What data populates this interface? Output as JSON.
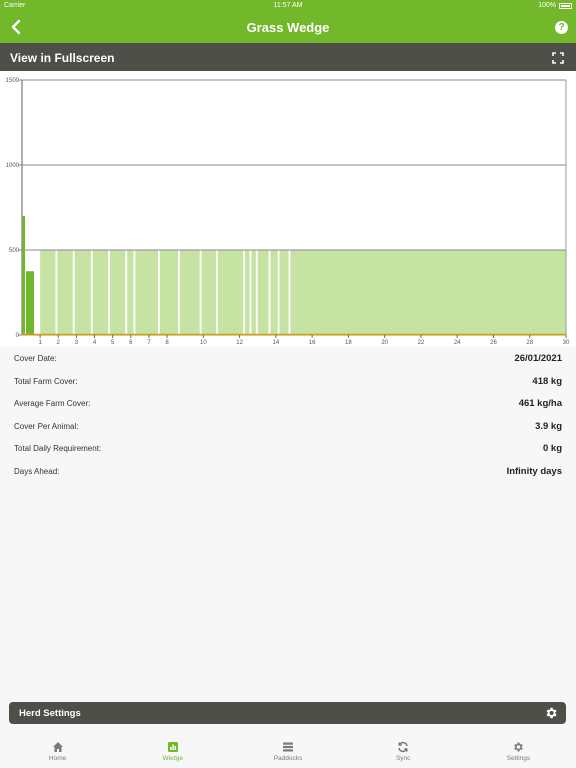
{
  "status_bar": {
    "carrier": "Carrier",
    "time": "11:57 AM",
    "battery": "100%"
  },
  "nav": {
    "title": "Grass Wedge"
  },
  "fullscreen_bar": {
    "label": "View in Fullscreen"
  },
  "stats": [
    {
      "label": "Cover Date:",
      "value": "26/01/2021"
    },
    {
      "label": "Total Farm Cover:",
      "value": "418 kg"
    },
    {
      "label": "Average Farm Cover:",
      "value": "461 kg/ha"
    },
    {
      "label": "Cover Per Animal:",
      "value": "3.9 kg"
    },
    {
      "label": "Total Daily Requirement:",
      "value": "0 kg"
    },
    {
      "label": "Days Ahead:",
      "value": "Infinity days"
    }
  ],
  "herd_settings": {
    "label": "Herd Settings"
  },
  "tabs": [
    {
      "label": "Home",
      "icon": "home-icon"
    },
    {
      "label": "Wedge",
      "icon": "bar-chart-icon"
    },
    {
      "label": "Paddocks",
      "icon": "list-icon"
    },
    {
      "label": "Sync",
      "icon": "sync-icon"
    },
    {
      "label": "Settings",
      "icon": "gear-icon"
    }
  ],
  "colors": {
    "brand_green": "#73b72b",
    "dark_bar": "#4d4f48",
    "bar_light": "#c6e3a4",
    "bar_dark": "#6db82e",
    "target_line": "#d6a100"
  },
  "chart_data": {
    "type": "bar",
    "ylim": [
      0,
      1500
    ],
    "yticks": [
      0,
      500,
      1000,
      1500
    ],
    "xticks": [
      1,
      2,
      3,
      4,
      5,
      6,
      7,
      8,
      10,
      12,
      14,
      16,
      18,
      20,
      22,
      24,
      26,
      28,
      30
    ],
    "xlim": [
      0,
      30
    ],
    "dark_bars": [
      {
        "x": 0.1,
        "value": 700
      },
      {
        "x": 0.5,
        "value": 375
      }
    ],
    "light_bar_value": 500,
    "light_bar_segments": [
      [
        1.0,
        1.85
      ],
      [
        1.95,
        2.8
      ],
      [
        2.9,
        3.8
      ],
      [
        3.9,
        4.75
      ],
      [
        4.85,
        5.7
      ],
      [
        5.8,
        6.15
      ],
      [
        6.25,
        7.5
      ],
      [
        7.6,
        8.6
      ],
      [
        8.7,
        9.8
      ],
      [
        9.9,
        10.7
      ],
      [
        10.8,
        12.2
      ],
      [
        12.3,
        12.55
      ],
      [
        12.65,
        12.9
      ],
      [
        13.0,
        13.6
      ],
      [
        13.7,
        14.1
      ],
      [
        14.2,
        14.7
      ],
      [
        14.8,
        30.0
      ]
    ],
    "target_line_value": 0
  }
}
